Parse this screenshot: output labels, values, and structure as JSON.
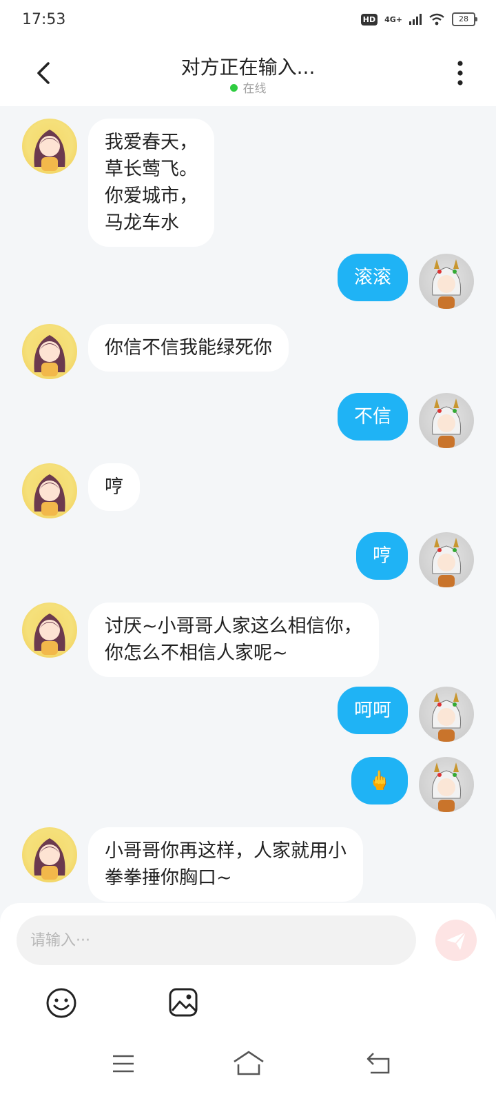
{
  "status_bar": {
    "time": "17:53",
    "hd": "HD",
    "network": "4G+",
    "battery": "28"
  },
  "header": {
    "title": "对方正在输入...",
    "status": "在线",
    "back_icon": "chevron-left-icon",
    "more_icon": "more-vertical-icon",
    "online_color": "#2ecc40"
  },
  "messages": [
    {
      "side": "left",
      "text": "我爱春天，\n草长莺飞。\n你爱城市，\n马龙车水"
    },
    {
      "side": "right",
      "text": "滚滚"
    },
    {
      "side": "left",
      "text": "你信不信我能绿死你"
    },
    {
      "side": "right",
      "text": "不信"
    },
    {
      "side": "left",
      "text": "哼"
    },
    {
      "side": "right",
      "text": "哼"
    },
    {
      "side": "left",
      "text": "讨厌~小哥哥人家这么相信你，\n你怎么不相信人家呢~"
    },
    {
      "side": "right",
      "text": "呵呵"
    },
    {
      "side": "right",
      "text": "🖕"
    },
    {
      "side": "left",
      "text": "小哥哥你再这样，人家就用小\n拳拳捶你胸口~"
    }
  ],
  "input": {
    "placeholder": "请输入···",
    "value": "",
    "send_icon": "paper-plane-icon",
    "emoji_icon": "smiley-icon",
    "image_icon": "image-icon"
  },
  "nav": {
    "menu_icon": "menu-icon",
    "home_icon": "home-icon",
    "back_icon": "back-arrow-icon"
  },
  "colors": {
    "outgoing_bubble": "#1fb3f5",
    "incoming_bubble": "#ffffff",
    "background": "#f4f6f8"
  }
}
